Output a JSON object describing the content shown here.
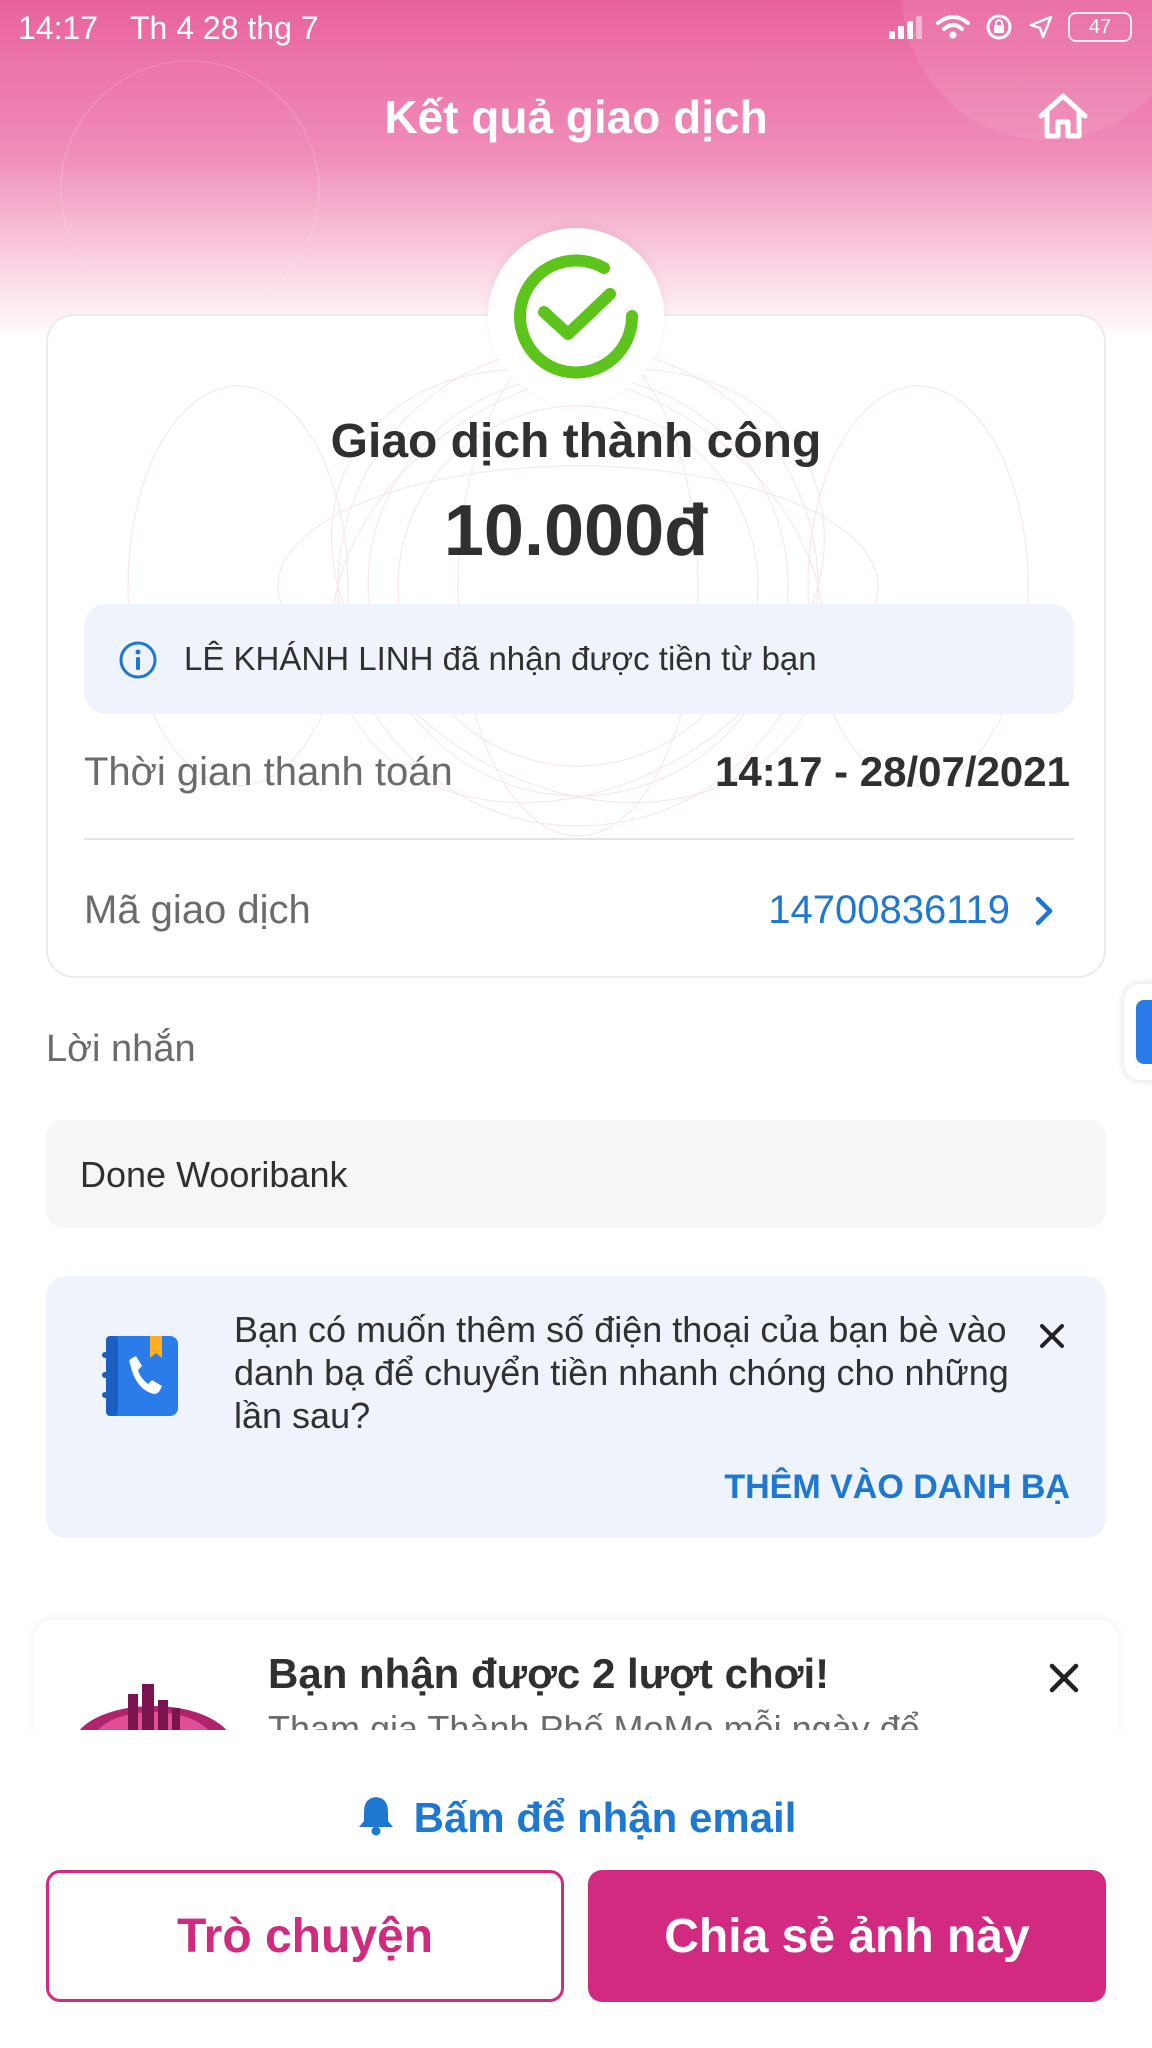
{
  "status_bar": {
    "time": "14:17",
    "date": "Th 4 28 thg 7",
    "battery": "47"
  },
  "header": {
    "title": "Kết quả giao dịch",
    "home_icon": "home-icon"
  },
  "result": {
    "status_icon": "check-circle-icon",
    "status_title": "Giao dịch thành công",
    "amount": "10.000đ",
    "info_text": "LÊ KHÁNH LINH đã nhận được tiền từ bạn",
    "payment_time_label": "Thời gian thanh toán",
    "payment_time_value": "14:17 - 28/07/2021",
    "transaction_id_label": "Mã giao dịch",
    "transaction_id_value": "14700836119"
  },
  "message": {
    "label": "Lời nhắn",
    "text": "Done Wooribank"
  },
  "contact_suggestion": {
    "text": "Bạn có muốn thêm số điện thoại của bạn bè vào danh bạ để chuyển tiền nhanh chóng cho những lần sau?",
    "action": "THÊM VÀO DANH BẠ"
  },
  "promo": {
    "title": "Bạn nhận được 2 lượt chơi!",
    "subtitle": "Tham gia Thành Phố MoMo mỗi ngày để"
  },
  "footer": {
    "email_link": "Bấm để nhận email",
    "chat_button": "Trò chuyện",
    "share_button": "Chia sẻ ảnh này"
  },
  "colors": {
    "brand_pink": "#d12a80",
    "link_blue": "#1f78d0",
    "success_green": "#5cc41a"
  }
}
